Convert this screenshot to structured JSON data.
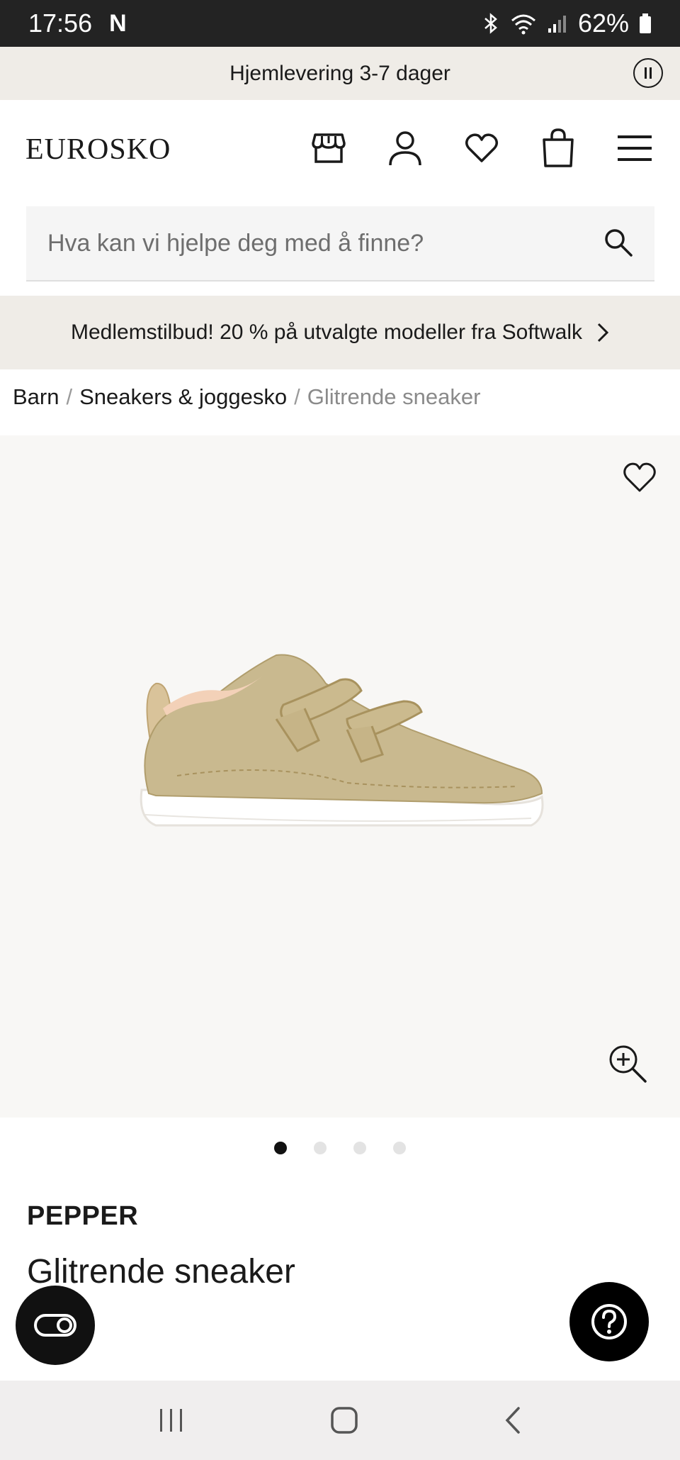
{
  "status_bar": {
    "time": "17:56",
    "app_letter": "N",
    "battery": "62%"
  },
  "promo": {
    "text": "Hjemlevering 3-7 dager"
  },
  "header": {
    "logo": "EUROSKO"
  },
  "search": {
    "placeholder": "Hva kan vi hjelpe deg med å finne?"
  },
  "member_offer": {
    "text": "Medlemstilbud! 20 % på utvalgte modeller fra Softwalk"
  },
  "breadcrumb": {
    "items": [
      "Barn",
      "Sneakers & joggesko"
    ],
    "separator": "/",
    "current": "Glitrende sneaker"
  },
  "gallery": {
    "image_count": 4,
    "active_index": 0
  },
  "product": {
    "brand": "PEPPER",
    "name": "Glitrende sneaker",
    "price_suffix": ",-"
  },
  "colors": {
    "accent_bar": "#efece7",
    "dark": "#111111"
  }
}
